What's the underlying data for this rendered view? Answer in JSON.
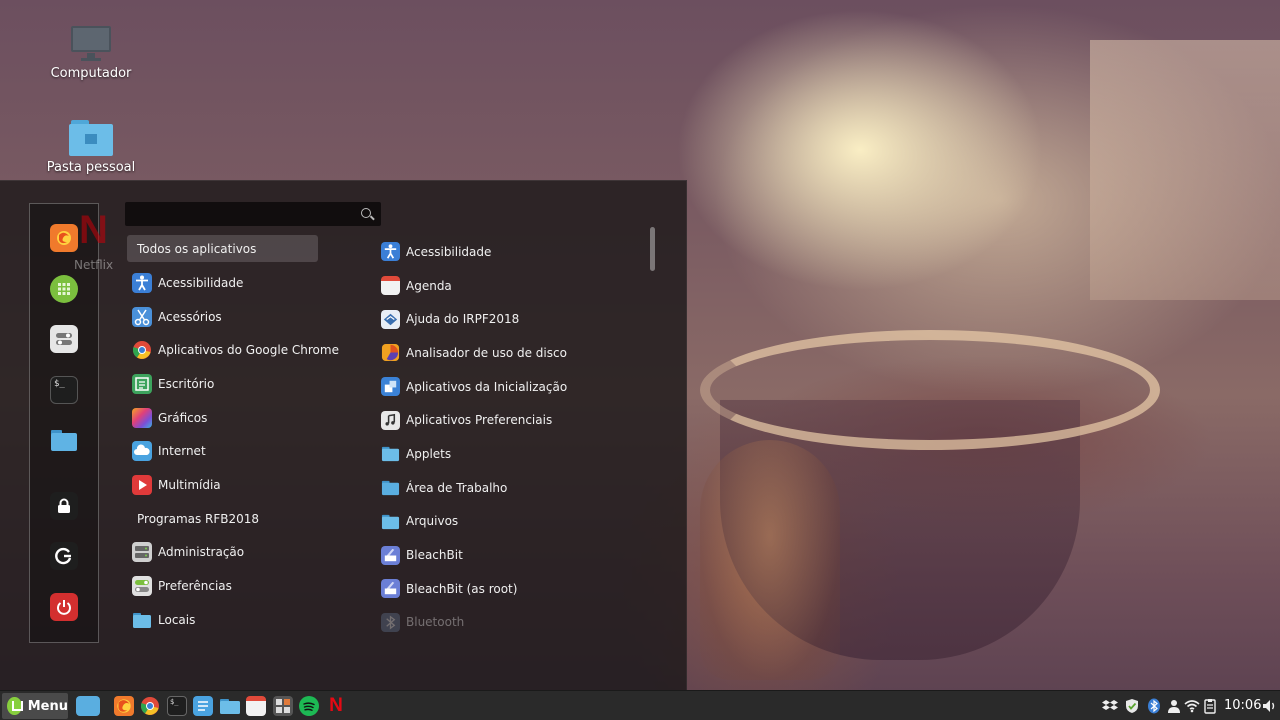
{
  "desktop": {
    "icons": [
      {
        "label": "Computador",
        "icon": "monitor-icon"
      },
      {
        "label": "Pasta pessoal",
        "icon": "home-folder-icon"
      }
    ],
    "ghost_label": "Netflix"
  },
  "menu": {
    "search": {
      "placeholder": ""
    },
    "favorites": [
      {
        "name": "firefox",
        "icon": "firefox-icon",
        "color": "#f07a2c"
      },
      {
        "name": "app-grid",
        "icon": "grid-icon",
        "color": "#7bbf3e"
      },
      {
        "name": "settings",
        "icon": "toggles-icon",
        "color": "#d8d8d8"
      },
      {
        "name": "terminal",
        "icon": "terminal-icon",
        "color": "#2b2b2b"
      },
      {
        "name": "files",
        "icon": "folder-icon",
        "color": "#5aaee0"
      },
      {
        "name": "lock",
        "icon": "lock-icon",
        "color": "#2b2b2b"
      },
      {
        "name": "logout",
        "icon": "logout-icon",
        "color": "#2b2b2b"
      },
      {
        "name": "shutdown",
        "icon": "power-icon",
        "color": "#d32f2f"
      }
    ],
    "categories": [
      {
        "label": "Todos os aplicativos",
        "icon": "",
        "color": ""
      },
      {
        "label": "Acessibilidade",
        "icon": "accessibility-icon",
        "color": "#3b7fd6"
      },
      {
        "label": "Acessórios",
        "icon": "scissors-icon",
        "color": "#4a90d9"
      },
      {
        "label": "Aplicativos do Google Chrome",
        "icon": "chrome-icon",
        "color": "#e04a3a"
      },
      {
        "label": "Escritório",
        "icon": "office-icon",
        "color": "#3da35d"
      },
      {
        "label": "Gráficos",
        "icon": "graphics-icon",
        "color": "#c04bd8"
      },
      {
        "label": "Internet",
        "icon": "cloud-icon",
        "color": "#4aa3e0"
      },
      {
        "label": "Multimídia",
        "icon": "play-icon",
        "color": "#e03a3a"
      },
      {
        "label": "Programas RFB2018",
        "icon": "",
        "color": ""
      },
      {
        "label": "Administração",
        "icon": "admin-icon",
        "color": "#cfcfcf"
      },
      {
        "label": "Preferências",
        "icon": "preferences-icon",
        "color": "#d0d0d0"
      },
      {
        "label": "Locais",
        "icon": "folder-icon",
        "color": "#6cbde8"
      }
    ],
    "apps": [
      {
        "label": "Acessibilidade",
        "icon": "accessibility-icon",
        "color": "#3b7fd6"
      },
      {
        "label": "Agenda",
        "icon": "calendar-icon",
        "color": "#f2f2f2"
      },
      {
        "label": "Ajuda do IRPF2018",
        "icon": "help-icon",
        "color": "#3a6fb0"
      },
      {
        "label": "Analisador de uso de disco",
        "icon": "disk-usage-icon",
        "color": "#f0a020"
      },
      {
        "label": "Aplicativos da Inicialização",
        "icon": "startup-icon",
        "color": "#3b82d6"
      },
      {
        "label": "Aplicativos Preferenciais",
        "icon": "music-file-icon",
        "color": "#e8e8e8"
      },
      {
        "label": "Applets",
        "icon": "folder-icon",
        "color": "#6cbde8"
      },
      {
        "label": "Área de Trabalho",
        "icon": "folder-icon",
        "color": "#5aaee0"
      },
      {
        "label": "Arquivos",
        "icon": "folder-icon",
        "color": "#6cbde8"
      },
      {
        "label": "BleachBit",
        "icon": "bleachbit-icon",
        "color": "#6b7fd6"
      },
      {
        "label": "BleachBit (as root)",
        "icon": "bleachbit-icon",
        "color": "#6b7fd6"
      },
      {
        "label": "Bluetooth",
        "icon": "bluetooth-icon",
        "color": "#6a7fa0"
      }
    ]
  },
  "taskbar": {
    "menu_label": "Menu",
    "launchers": [
      {
        "name": "show-desktop",
        "icon": "desktop-icon",
        "color": "#5aaee0"
      },
      {
        "name": "firefox",
        "icon": "firefox-icon",
        "color": "#f07a2c"
      },
      {
        "name": "chrome",
        "icon": "chrome-icon",
        "color": "#e04a3a"
      },
      {
        "name": "terminal",
        "icon": "terminal-icon",
        "color": "#333333"
      },
      {
        "name": "text-editor",
        "icon": "text-editor-icon",
        "color": "#4aa3e0"
      },
      {
        "name": "files",
        "icon": "folder-icon",
        "color": "#6cbde8"
      },
      {
        "name": "calendar",
        "icon": "calendar-icon",
        "color": "#f2f2f2"
      },
      {
        "name": "calculator",
        "icon": "calculator-icon",
        "color": "#555555"
      },
      {
        "name": "spotify",
        "icon": "spotify-icon",
        "color": "#1db954"
      },
      {
        "name": "netflix",
        "icon": "netflix-icon",
        "color": "#e50914"
      }
    ],
    "tray": [
      {
        "name": "dropbox",
        "icon": "dropbox-icon"
      },
      {
        "name": "shield",
        "icon": "shield-icon"
      },
      {
        "name": "bluetooth",
        "icon": "bluetooth-icon"
      },
      {
        "name": "user",
        "icon": "user-icon"
      },
      {
        "name": "wifi",
        "icon": "wifi-icon"
      },
      {
        "name": "clipboard",
        "icon": "clipboard-icon"
      },
      {
        "name": "volume",
        "icon": "volume-icon"
      }
    ],
    "clock": "10:06"
  }
}
